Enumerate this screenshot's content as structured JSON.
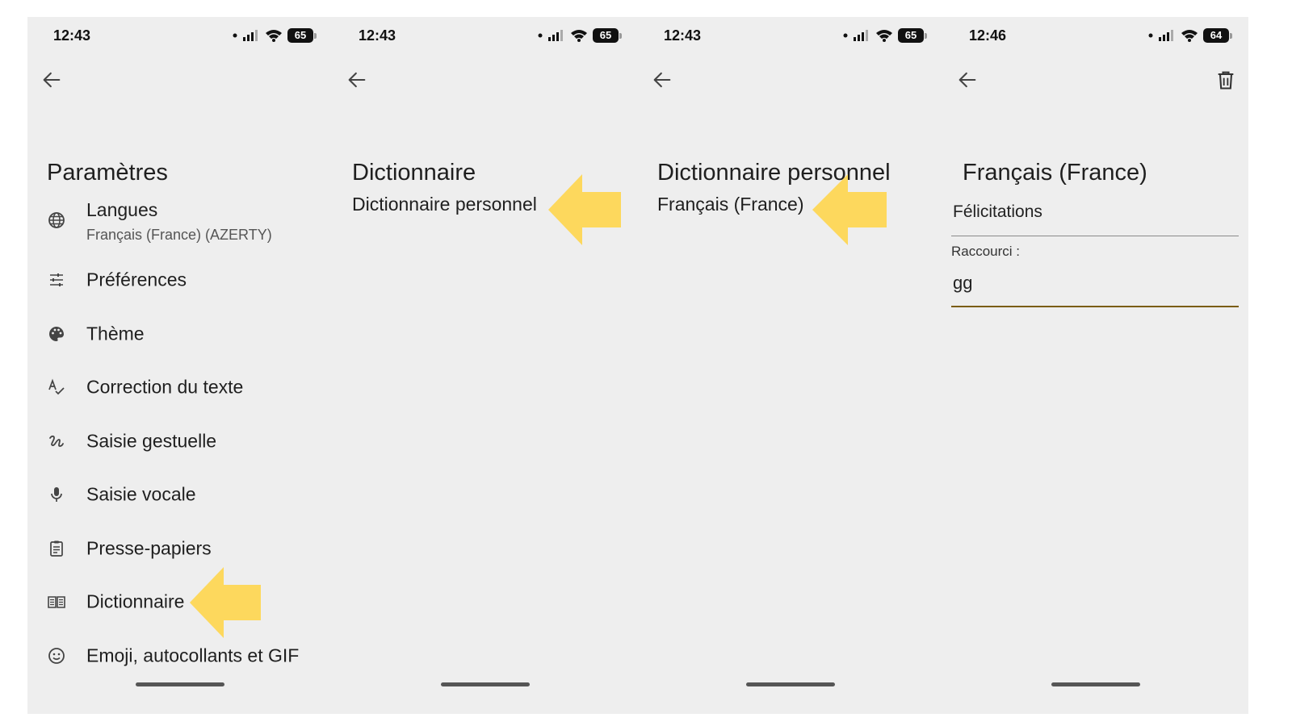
{
  "colors": {
    "screen_bg": "#eeeeee",
    "arrow": "#fdd85d",
    "text": "#1f1f1f",
    "field_focus": "#7a5d10"
  },
  "screens": [
    {
      "time": "12:43",
      "battery": "65",
      "title": "Paramètres",
      "menu": [
        {
          "icon": "globe-icon",
          "label": "Langues",
          "sub": "Français (France) (AZERTY)"
        },
        {
          "icon": "sliders-icon",
          "label": "Préférences"
        },
        {
          "icon": "palette-icon",
          "label": "Thème"
        },
        {
          "icon": "spellcheck-icon",
          "label": "Correction du texte"
        },
        {
          "icon": "gesture-icon",
          "label": "Saisie gestuelle"
        },
        {
          "icon": "mic-icon",
          "label": "Saisie vocale"
        },
        {
          "icon": "clipboard-icon",
          "label": "Presse-papiers"
        },
        {
          "icon": "book-icon",
          "label": "Dictionnaire"
        },
        {
          "icon": "emoji-icon",
          "label": "Emoji, autocollants et GIF"
        }
      ]
    },
    {
      "time": "12:43",
      "battery": "65",
      "title": "Dictionnaire",
      "item": "Dictionnaire personnel"
    },
    {
      "time": "12:43",
      "battery": "65",
      "title": "Dictionnaire personnel",
      "item": "Français (France)"
    },
    {
      "time": "12:46",
      "battery": "64",
      "title": "Français (France)",
      "word": "Félicitations",
      "shortcut_label": "Raccourci :",
      "shortcut_value": "gg"
    }
  ]
}
